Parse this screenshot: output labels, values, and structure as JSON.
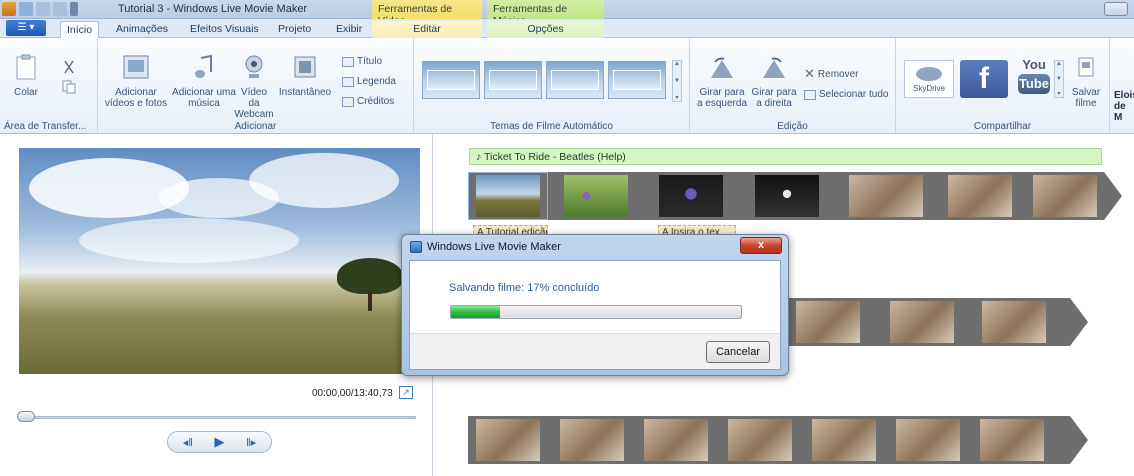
{
  "window": {
    "title": "Tutorial 3 - Windows Live Movie Maker",
    "context_video": "Ferramentas de Vídeo",
    "context_music": "Ferramentas de Música"
  },
  "tabs": [
    "Início",
    "Animações",
    "Efeitos Visuais",
    "Projeto",
    "Exibir",
    "Editar",
    "Opções"
  ],
  "ribbon": {
    "clipboard": {
      "paste": "Colar",
      "label": "Área de Transfer..."
    },
    "add": {
      "add_videos": "Adicionar vídeos e fotos",
      "add_music": "Adicionar uma música",
      "webcam": "Vídeo da Webcam",
      "snapshot": "Instantâneo",
      "title": "Título",
      "caption": "Legenda",
      "credits": "Créditos",
      "label": "Adicionar"
    },
    "themes": {
      "label": "Temas de Filme Automático"
    },
    "edit": {
      "rotate_left": "Girar para a esquerda",
      "rotate_right": "Girar para a direita",
      "remove": "Remover",
      "select_all": "Selecionar tudo",
      "label": "Edição"
    },
    "share": {
      "skydrive": "SkyDrive",
      "facebook": "f",
      "youtube_top": "You",
      "youtube_bottom": "Tube",
      "save_movie": "Salvar filme",
      "label": "Compartilhar",
      "extra": "Elois de M"
    }
  },
  "preview": {
    "timecode": "00:00,00/13:40,73"
  },
  "storyboard": {
    "music_track": "Ticket To Ride - Beatles (Help)",
    "caption1": "A Tutorial edição",
    "caption2": "A Insira o tex"
  },
  "dialog": {
    "title": "Windows Live Movie Maker",
    "close": "x",
    "message": "Salvando filme: 17% concluído",
    "progress": 0.17,
    "cancel": "Cancelar"
  }
}
